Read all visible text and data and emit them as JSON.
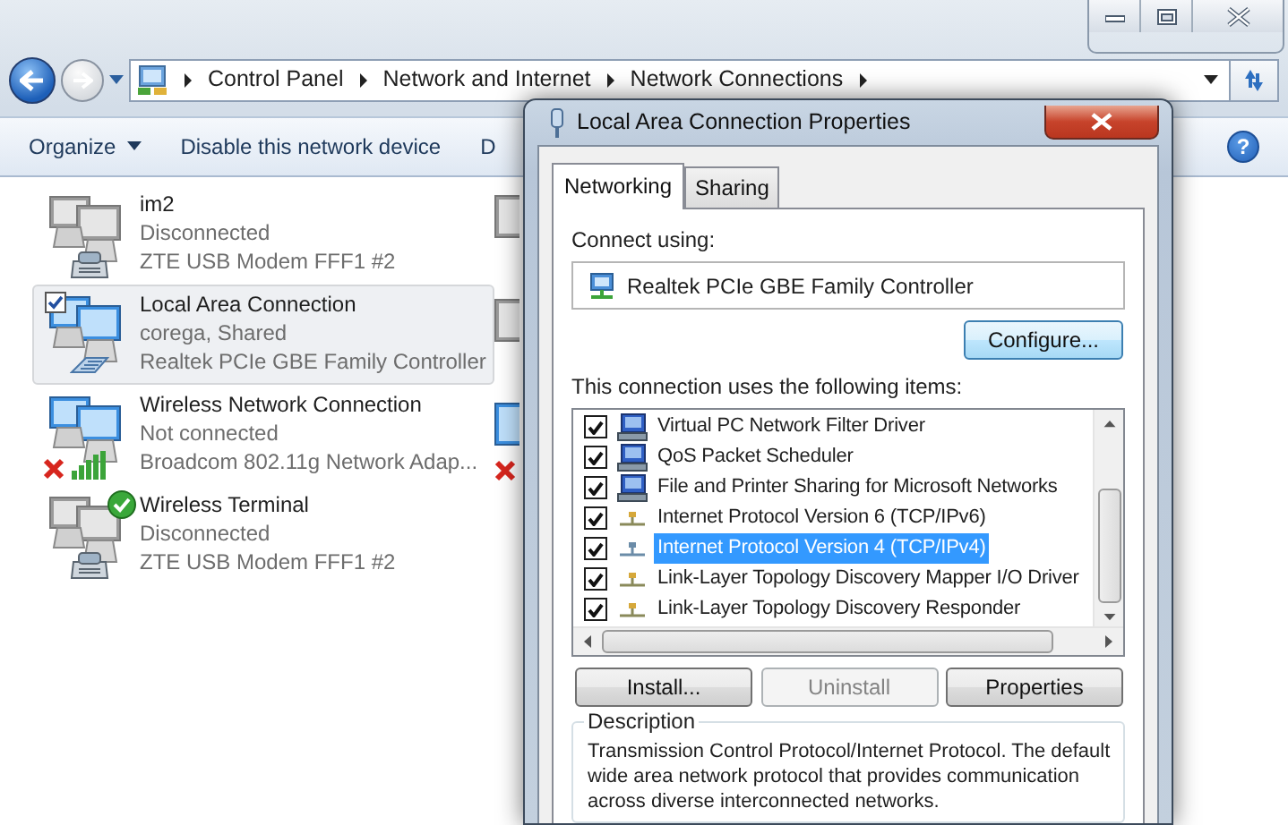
{
  "address_bar": {
    "crumbs": [
      "Control Panel",
      "Network and Internet",
      "Network Connections"
    ]
  },
  "toolbar": {
    "buttons": [
      {
        "label": "Organize",
        "dropdown": true
      },
      {
        "label": "Disable this network device",
        "dropdown": false
      },
      {
        "label": "D",
        "dropdown": false
      }
    ],
    "help_button": "?"
  },
  "connections": [
    {
      "name": "im2",
      "status": "Disconnected",
      "device": "ZTE USB Modem FFF1 #2",
      "selected": false,
      "kind": "modem",
      "error": false,
      "ok": false,
      "connected": false
    },
    {
      "name": "Local Area Connection",
      "status": "corega, Shared",
      "device": "Realtek PCIe GBE Family Controller",
      "selected": true,
      "kind": "cable",
      "error": false,
      "ok": false,
      "connected": true
    },
    {
      "name": "Wireless Network Connection",
      "status": "Not connected",
      "device": "Broadcom 802.11g Network Adap...",
      "selected": false,
      "kind": "wireless",
      "error": true,
      "ok": false,
      "connected": true
    },
    {
      "name": "Wireless Terminal",
      "status": "Disconnected",
      "device": "ZTE USB Modem FFF1 #2",
      "selected": false,
      "kind": "modem",
      "error": false,
      "ok": true,
      "connected": false
    }
  ],
  "hidden_column": [
    {
      "connected": false,
      "error": false
    },
    {
      "connected": false,
      "error": false
    },
    {
      "connected": true,
      "error": true
    }
  ],
  "dialog": {
    "title": "Local Area Connection Properties",
    "tabs": [
      {
        "label": "Networking",
        "selected": true
      },
      {
        "label": "Sharing",
        "selected": false
      }
    ],
    "connect_using_label": "Connect using:",
    "adapter": "Realtek PCIe GBE Family Controller",
    "configure_button": "Configure...",
    "items_label": "This connection uses the following items:",
    "items": [
      {
        "label": "Virtual PC Network Filter Driver",
        "checked": true,
        "selected": false,
        "kind": "service"
      },
      {
        "label": "QoS Packet Scheduler",
        "checked": true,
        "selected": false,
        "kind": "service"
      },
      {
        "label": "File and Printer Sharing for Microsoft Networks",
        "checked": true,
        "selected": false,
        "kind": "service"
      },
      {
        "label": "Internet Protocol Version 6 (TCP/IPv6)",
        "checked": true,
        "selected": false,
        "kind": "protocol"
      },
      {
        "label": "Internet Protocol Version 4 (TCP/IPv4)",
        "checked": true,
        "selected": true,
        "kind": "protocol"
      },
      {
        "label": "Link-Layer Topology Discovery Mapper I/O Driver",
        "checked": true,
        "selected": false,
        "kind": "protocol"
      },
      {
        "label": "Link-Layer Topology Discovery Responder",
        "checked": true,
        "selected": false,
        "kind": "protocol"
      }
    ],
    "buttons": [
      {
        "label": "Install...",
        "disabled": false
      },
      {
        "label": "Uninstall",
        "disabled": true
      },
      {
        "label": "Properties",
        "disabled": false
      }
    ],
    "description": {
      "legend": "Description",
      "text": "Transmission Control Protocol/Internet Protocol. The default wide area network protocol that provides communication across diverse interconnected networks."
    }
  }
}
